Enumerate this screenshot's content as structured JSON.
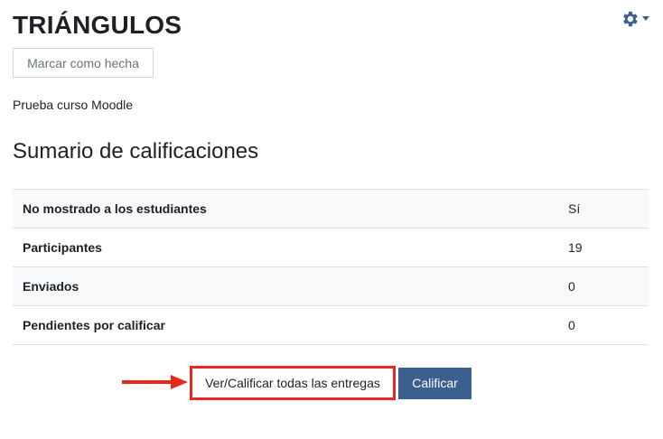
{
  "header": {
    "title": "TRIÁNGULOS",
    "mark_done_label": "Marcar como hecha",
    "settings_icon": "gear-icon",
    "settings_caret_icon": "caret-down-icon"
  },
  "course": {
    "name": "Prueba curso Moodle"
  },
  "summary": {
    "title": "Sumario de calificaciones",
    "rows": [
      {
        "label": "No mostrado a los estudiantes",
        "value": "Sí"
      },
      {
        "label": "Participantes",
        "value": "19"
      },
      {
        "label": "Enviados",
        "value": "0"
      },
      {
        "label": "Pendientes por calificar",
        "value": "0"
      }
    ]
  },
  "actions": {
    "view_all_label": "Ver/Calificar todas las entregas",
    "grade_label": "Calificar"
  },
  "colors": {
    "primary": "#3b5f8f",
    "highlight": "#e8291c",
    "row_alt": "#f8f9fa",
    "border": "#dee2e6"
  }
}
